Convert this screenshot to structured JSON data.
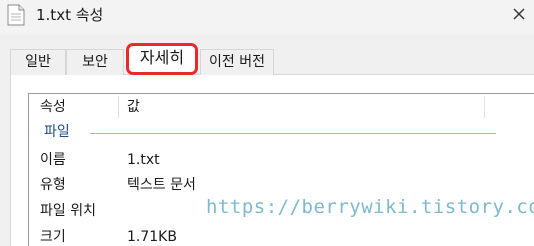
{
  "window": {
    "title": "1.txt 속성",
    "file_icon": "text-file-icon",
    "close_icon": "close-icon"
  },
  "tabs": [
    {
      "label": "일반",
      "selected": false
    },
    {
      "label": "보안",
      "selected": false
    },
    {
      "label": "자세히",
      "selected": true
    },
    {
      "label": "이전 버전",
      "selected": false
    }
  ],
  "details": {
    "columns": {
      "property": "속성",
      "value": "값"
    },
    "group": "파일",
    "rows": [
      {
        "property": "이름",
        "value": "1.txt"
      },
      {
        "property": "유형",
        "value": "텍스트 문서"
      },
      {
        "property": "파일 위치",
        "value": ""
      },
      {
        "property": "크기",
        "value": "1.71KB"
      }
    ]
  },
  "watermark": "https://berrywiki.tistory.com",
  "colors": {
    "highlight": "#e82a2a",
    "group_label": "#1e4e8c",
    "watermark": "#7eb9cf"
  }
}
